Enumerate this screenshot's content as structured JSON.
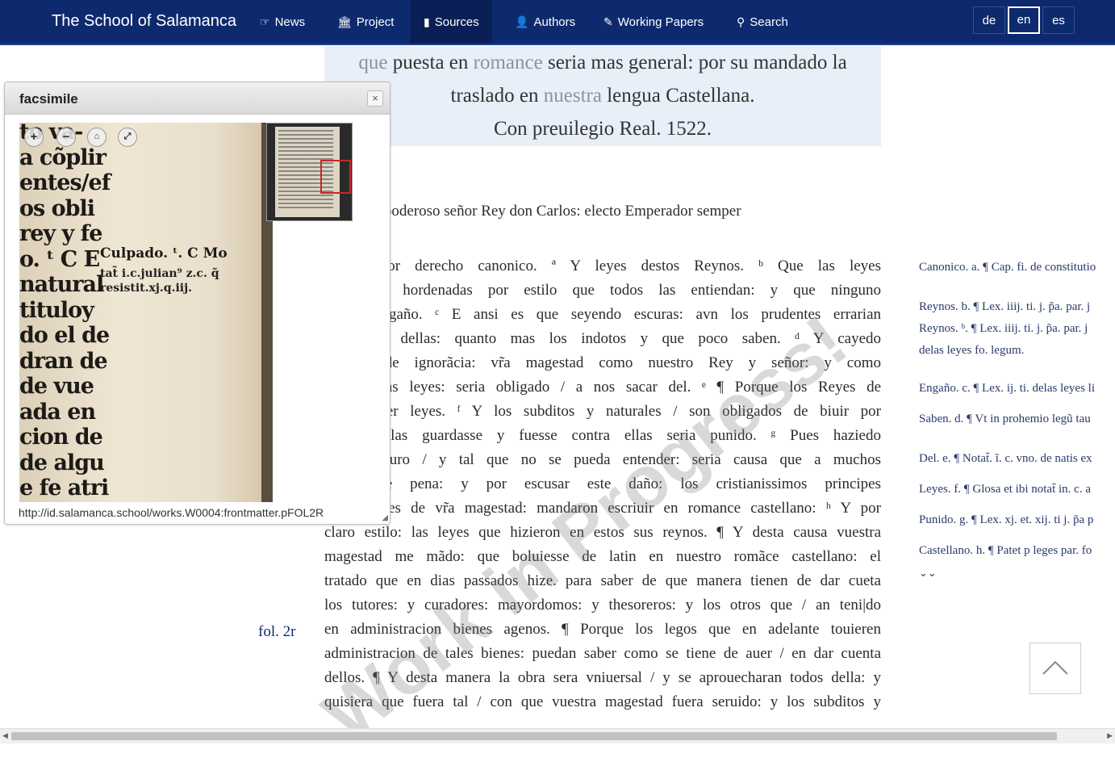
{
  "nav": {
    "brand": "The School of Salamanca",
    "items": [
      {
        "label": "News",
        "icon": "hand-point-icon"
      },
      {
        "label": "Project",
        "icon": "institution-icon"
      },
      {
        "label": "Sources",
        "icon": "file-icon",
        "active": true
      },
      {
        "label": "Authors",
        "icon": "user-icon"
      },
      {
        "label": "Working Papers",
        "icon": "pencil-icon"
      },
      {
        "label": "Search",
        "icon": "search-icon"
      }
    ],
    "languages": [
      "de",
      "en",
      "es"
    ],
    "active_language": "en"
  },
  "title": {
    "line1_a": "que",
    "line1_b": " puesta en ",
    "line1_c": "romance",
    "line1_d": " seria mas general: por su mandado la",
    "line2_a": "traslado en ",
    "line2_b": "nuestra",
    "line2_c": " lengua Castellana.",
    "line3": "Con preuilegio Real. 1522."
  },
  "intro": "alto Muy poderoso señor Rey don Carlos: electo Emperador semper",
  "body_lines": [
    "escrito por derecho canonico. ª Y leyes destos Reynos. ᵇ Que las leyes",
    "claras: y hordenadas por estilo que todos las entiendan: y que ninguno",
    "reciba engaño. ᶜ E ansi es que seyendo escuras: avn los prudentes errarian",
    "ndimiento dellas: quanto mas los indotos y que poco saben. ᵈ Y cayedo",
    "l lazo de ignorãcia: vr̃a magestad como nuestro Rey y señor: y como",
    "elas dichas leyes: seria obligado / a nos sacar del. ᵉ ¶ Porque los Reyes de",
    "eden hazer leyes. ᶠ Y los subditos y naturales / son obligados de biuir por",
    "que no las guardasse y fuesse contra ellas seria punido. ᵍ Pues haziedo",
    "estilo escuro / y tal que no se pueda entender: seria causa que a muchos",
    "se diesse pena: y por escusar este daño: los cristianissimos principes",
    "antecessores de vr̃a magestad: mandaron escriuir en romance castellano: ʰ Y por",
    "claro estilo: las leyes que hizieron en estos sus reynos. ¶ Y desta causa vuestra",
    "magestad me mãdo: que boluiesse de latin en nuestro romãce castellano: el",
    "tratado que en dias passados hize. para saber de que manera tienen de dar cueta",
    "los tutores: y curadores: mayordomos: y thesoreros: y los otros que / an teni|do",
    "en administracion bienes agenos. ¶ Porque los legos que en adelante touieren",
    "administracion de tales bienes: puedan saber como se tiene de auer / en dar cuenta",
    "dellos. ¶ Y desta manera la obra sera vniuersal / y se aprouecharan todos della: y",
    "quisiera que fuera tal / con que vuestra magestad fuera seruido: y los subditos y"
  ],
  "folio": "fol. 2r",
  "notes": [
    "Canonico. a. ¶ Cap. fi. de constitutio",
    "Reynos. b. ¶ Lex. iiij. ti. j. p̃a. par. j",
    "Reynos. ᵇ. ¶ Lex. iiij. ti. j. p̃a. par. j",
    "delas leyes fo. legum.",
    "Engaño. c. ¶ Lex. ij. ti. delas leyes li",
    "Saben. d. ¶ Vt in prohemio legũ tau",
    "Del. e. ¶ Notat̃. ĩ. c. vno. de natis ex",
    "Leyes. f. ¶ Glosa et ibi notat̃ in. c. a",
    "Punido. g. ¶ Lex. xj. et. xij. ti j. p̃a p",
    "Castellano. h. ¶ Patet p leges par. fo"
  ],
  "watermark": "Work in Progress!",
  "facsimile": {
    "title": "facsimile",
    "close": "×",
    "url": "http://id.salamanca.school/works.W0004:frontmatter.pFOL2R",
    "scan_lines": [
      "to va-",
      "a cõplir",
      "entes/ef",
      "os obli",
      "rey y fe",
      "o. ᵗ C E",
      "natural",
      "tituloy",
      "do el de",
      "dran de",
      "de vue",
      "ada en",
      "cion de",
      "de algu",
      "e fe atri"
    ],
    "margin_note_1": "Culpado. ᵗ. C Mo",
    "margin_note_2": "tat̃ i.c.julian⁹ z.c. q̃",
    "margin_note_3": "resistit.xj.q.iij."
  }
}
